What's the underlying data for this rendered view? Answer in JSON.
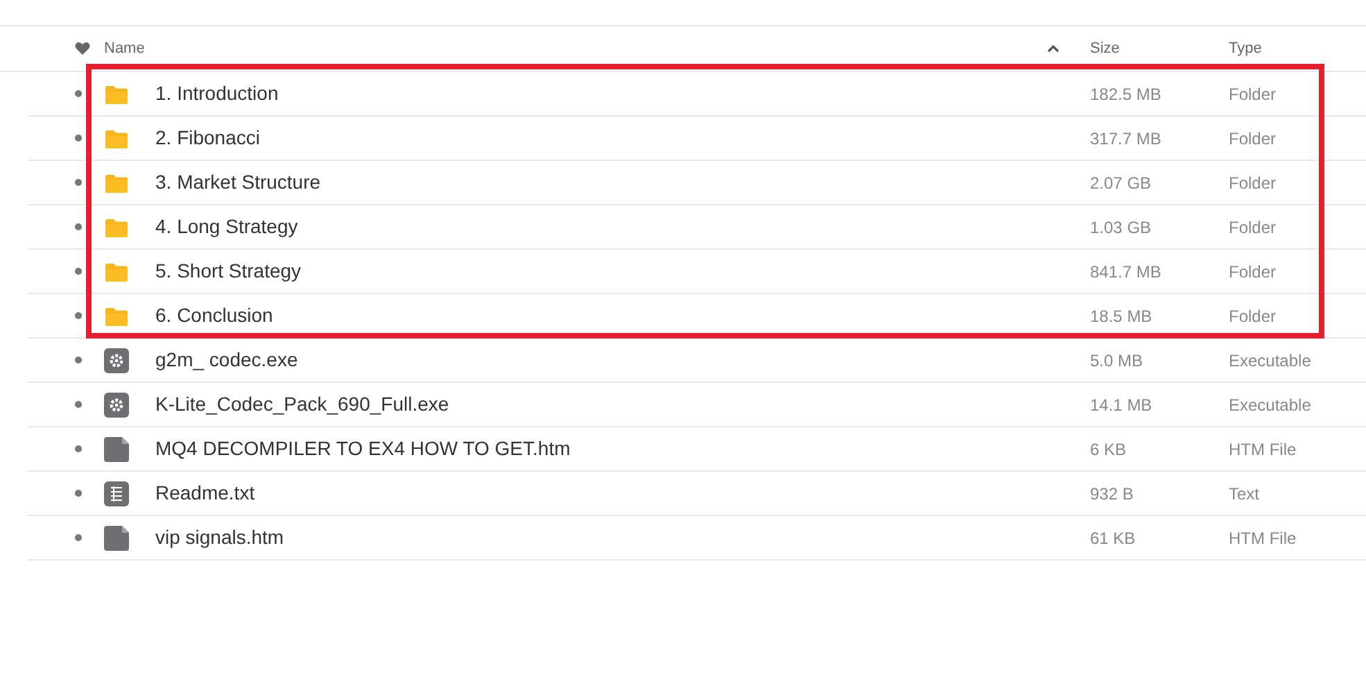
{
  "table": {
    "columns": [
      {
        "label": "Name",
        "sorted": true
      },
      {
        "label": "Size",
        "sorted": false
      },
      {
        "label": "Type",
        "sorted": false
      }
    ],
    "rows": [
      {
        "kind": "folder",
        "name": "1. Introduction",
        "size": "182.5 MB",
        "type": "Folder",
        "highlighted": true
      },
      {
        "kind": "folder",
        "name": "2. Fibonacci",
        "size": "317.7 MB",
        "type": "Folder",
        "highlighted": true
      },
      {
        "kind": "folder",
        "name": "3. Market Structure",
        "size": "2.07 GB",
        "type": "Folder",
        "highlighted": true
      },
      {
        "kind": "folder",
        "name": "4. Long Strategy",
        "size": "1.03 GB",
        "type": "Folder",
        "highlighted": true
      },
      {
        "kind": "folder",
        "name": "5. Short Strategy",
        "size": "841.7 MB",
        "type": "Folder",
        "highlighted": true
      },
      {
        "kind": "folder",
        "name": "6. Conclusion",
        "size": "18.5 MB",
        "type": "Folder",
        "highlighted": true
      },
      {
        "kind": "executable",
        "name": "g2m_ codec.exe",
        "size": "5.0 MB",
        "type": "Executable",
        "highlighted": false
      },
      {
        "kind": "executable",
        "name": "K-Lite_Codec_Pack_690_Full.exe",
        "size": "14.1 MB",
        "type": "Executable",
        "highlighted": false
      },
      {
        "kind": "file",
        "name": "MQ4 DECOMPILER TO EX4 HOW TO GET.htm",
        "size": "6 KB",
        "type": "HTM File",
        "highlighted": false
      },
      {
        "kind": "text",
        "name": "Readme.txt",
        "size": "932 B",
        "type": "Text",
        "highlighted": false
      },
      {
        "kind": "file",
        "name": "vip signals.htm",
        "size": "61 KB",
        "type": "HTM File",
        "highlighted": false
      }
    ]
  }
}
